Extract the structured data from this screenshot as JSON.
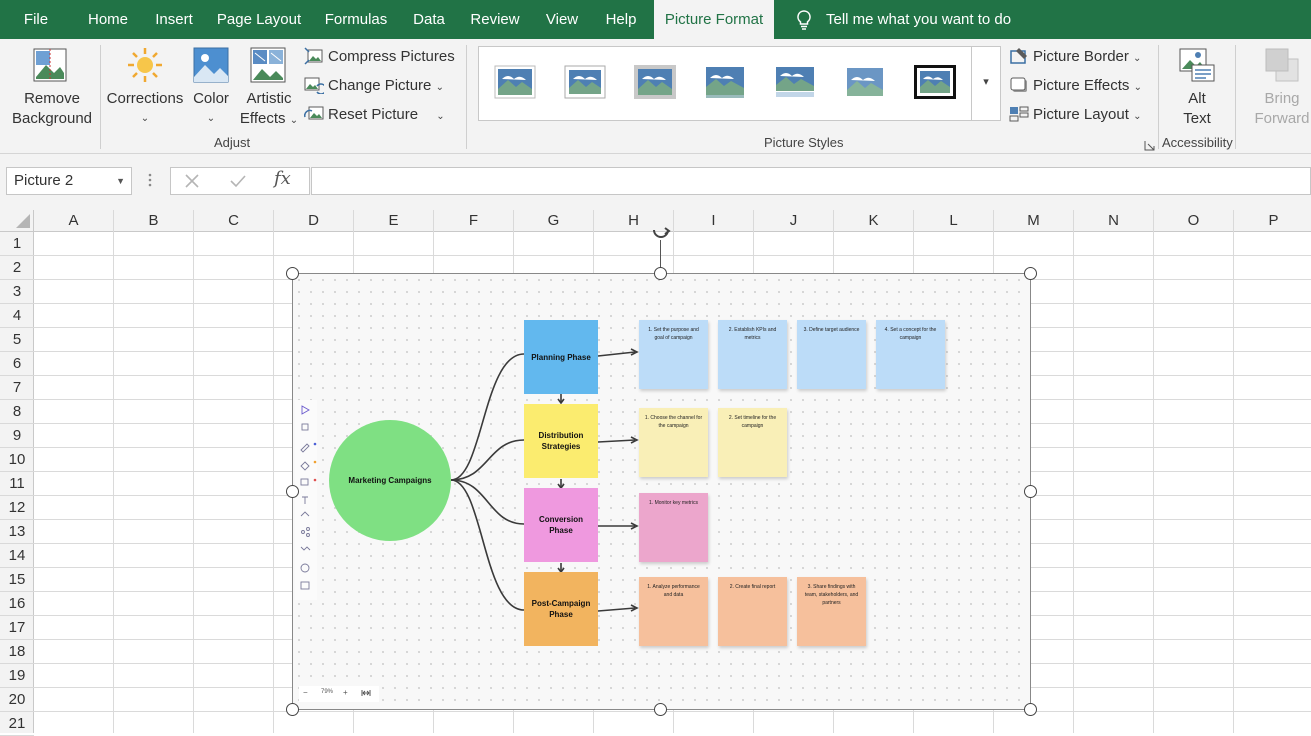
{
  "menu": {
    "tabs": [
      "File",
      "Home",
      "Insert",
      "Page Layout",
      "Formulas",
      "Data",
      "Review",
      "View",
      "Help",
      "Picture Format"
    ],
    "active_tab": "Picture Format",
    "tell_me": "Tell me what you want to do"
  },
  "ribbon": {
    "remove_background": {
      "line1": "Remove",
      "line2": "Background"
    },
    "corrections": "Corrections",
    "color": "Color",
    "artistic_effects": {
      "line1": "Artistic",
      "line2": "Effects"
    },
    "compress_pictures": "Compress Pictures",
    "change_picture": "Change Picture",
    "reset_picture": "Reset Picture",
    "adjust_group": "Adjust",
    "picture_styles_group": "Picture Styles",
    "picture_border": "Picture Border",
    "picture_effects": "Picture Effects",
    "picture_layout": "Picture Layout",
    "alt_text": {
      "line1": "Alt",
      "line2": "Text"
    },
    "accessibility_group": "Accessibility",
    "bring_forward": {
      "line1": "Bring",
      "line2": "Forward"
    }
  },
  "formula_bar": {
    "name_box": "Picture 2",
    "fx": "fx",
    "value": ""
  },
  "sheet": {
    "columns": [
      "A",
      "B",
      "C",
      "D",
      "E",
      "F",
      "G",
      "H",
      "I",
      "J",
      "K",
      "L",
      "M",
      "N",
      "O",
      "P"
    ],
    "rows": [
      "1",
      "2",
      "3",
      "4",
      "5",
      "6",
      "7",
      "8",
      "9",
      "10",
      "11",
      "12",
      "13",
      "14",
      "15",
      "16",
      "17",
      "18",
      "19",
      "20",
      "21"
    ]
  },
  "picture": {
    "center": "Marketing Campaigns",
    "phases": [
      {
        "label": "Planning Phase",
        "color": "#62b8ee",
        "notes": [
          {
            "text": "1. Set the purpose and goal of campaign",
            "color": "#bcdcf8"
          },
          {
            "text": "2. Establish KPIs and metrics",
            "color": "#bcdcf8"
          },
          {
            "text": "3. Define target audience",
            "color": "#bcdcf8"
          },
          {
            "text": "4. Set a concept for the campaign",
            "color": "#bcdcf8"
          }
        ]
      },
      {
        "label": "Distribution Strategies",
        "color": "#fbec6f",
        "notes": [
          {
            "text": "1. Choose the channel for the campaign",
            "color": "#f9efb7"
          },
          {
            "text": "2. Set timeline for the campaign",
            "color": "#f9efb7"
          }
        ]
      },
      {
        "label": "Conversion Phase",
        "color": "#ef99df",
        "notes": [
          {
            "text": "1. Monitor key metrics",
            "color": "#eca6cc"
          }
        ]
      },
      {
        "label": "Post-Campaign Phase",
        "color": "#f2b45f",
        "notes": [
          {
            "text": "1. Analyze performance and data",
            "color": "#f6c09c"
          },
          {
            "text": "2. Create final report",
            "color": "#f6c09c"
          },
          {
            "text": "3. Share findings with team, stakeholders, and partners",
            "color": "#f6c09c"
          }
        ]
      }
    ],
    "zoom": "79%",
    "zoom_out": "−",
    "zoom_in": "+"
  },
  "colors": {
    "excel_green": "#217346",
    "ribbon_bg": "#f3f3f3"
  }
}
